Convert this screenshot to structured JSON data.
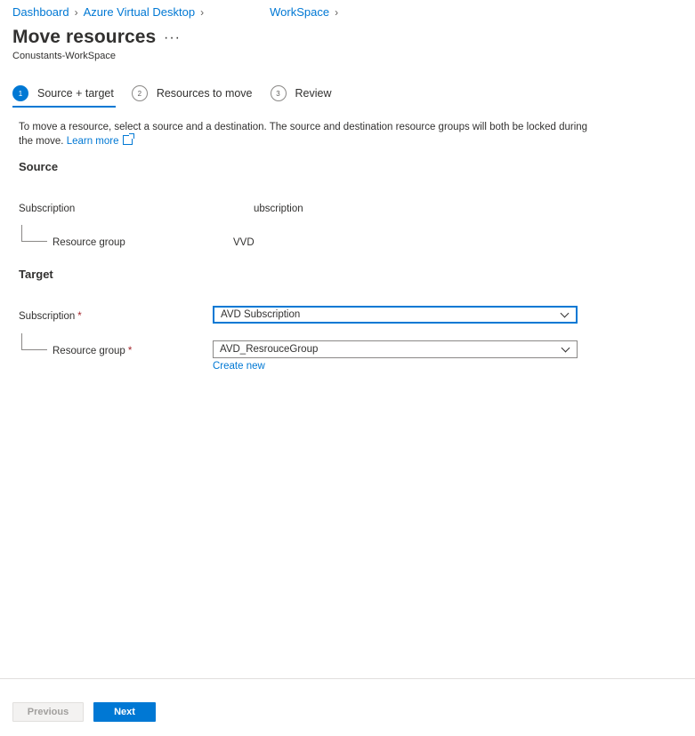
{
  "breadcrumb": {
    "items": [
      "Dashboard",
      "Azure Virtual Desktop",
      "WorkSpace"
    ]
  },
  "header": {
    "title": "Move resources",
    "more": "···",
    "subtitle": "Conustants-WorkSpace"
  },
  "steps": [
    {
      "number": "1",
      "label": "Source + target"
    },
    {
      "number": "2",
      "label": "Resources to move"
    },
    {
      "number": "3",
      "label": "Review"
    }
  ],
  "description": {
    "text": "To move a resource, select a source and a destination. The source and destination resource groups will both be locked during the move.",
    "learn_more": "Learn more"
  },
  "source": {
    "heading": "Source",
    "subscription_label": "Subscription",
    "subscription_value": "ubscription",
    "resource_group_label": "Resource group",
    "resource_group_value": "VVD"
  },
  "target": {
    "heading": "Target",
    "subscription_label": "Subscription",
    "subscription_value": "AVD Subscription",
    "resource_group_label": "Resource group",
    "resource_group_value": "AVD_ResrouceGroup",
    "create_new": "Create new",
    "required_marker": "*"
  },
  "footer": {
    "previous_label": "Previous",
    "next_label": "Next"
  },
  "colors": {
    "accent": "#0078d4",
    "required": "#a4262c"
  }
}
